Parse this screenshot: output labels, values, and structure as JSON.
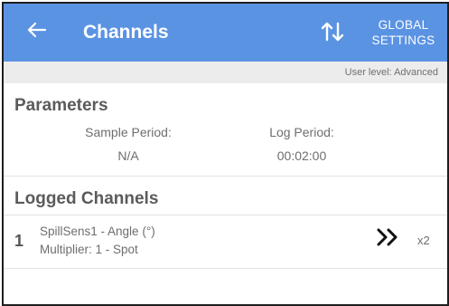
{
  "appbar": {
    "title": "Channels",
    "global_settings_line1": "GLOBAL",
    "global_settings_line2": "SETTINGS",
    "color": "#5b93e3"
  },
  "user_level": "User level: Advanced",
  "parameters": {
    "title": "Parameters",
    "sample_period_label": "Sample Period:",
    "sample_period_value": "N/A",
    "log_period_label": "Log Period:",
    "log_period_value": "00:02:00"
  },
  "logged_channels": {
    "title": "Logged Channels",
    "items": [
      {
        "index": "1",
        "name": "SpillSens1 - Angle (°)",
        "multiplier": "Multiplier: 1 - Spot",
        "count": "x2"
      }
    ]
  },
  "icons": {
    "back": "arrow-left-icon",
    "sort": "sort-arrows-icon",
    "expand": "double-chevron-right-icon"
  }
}
